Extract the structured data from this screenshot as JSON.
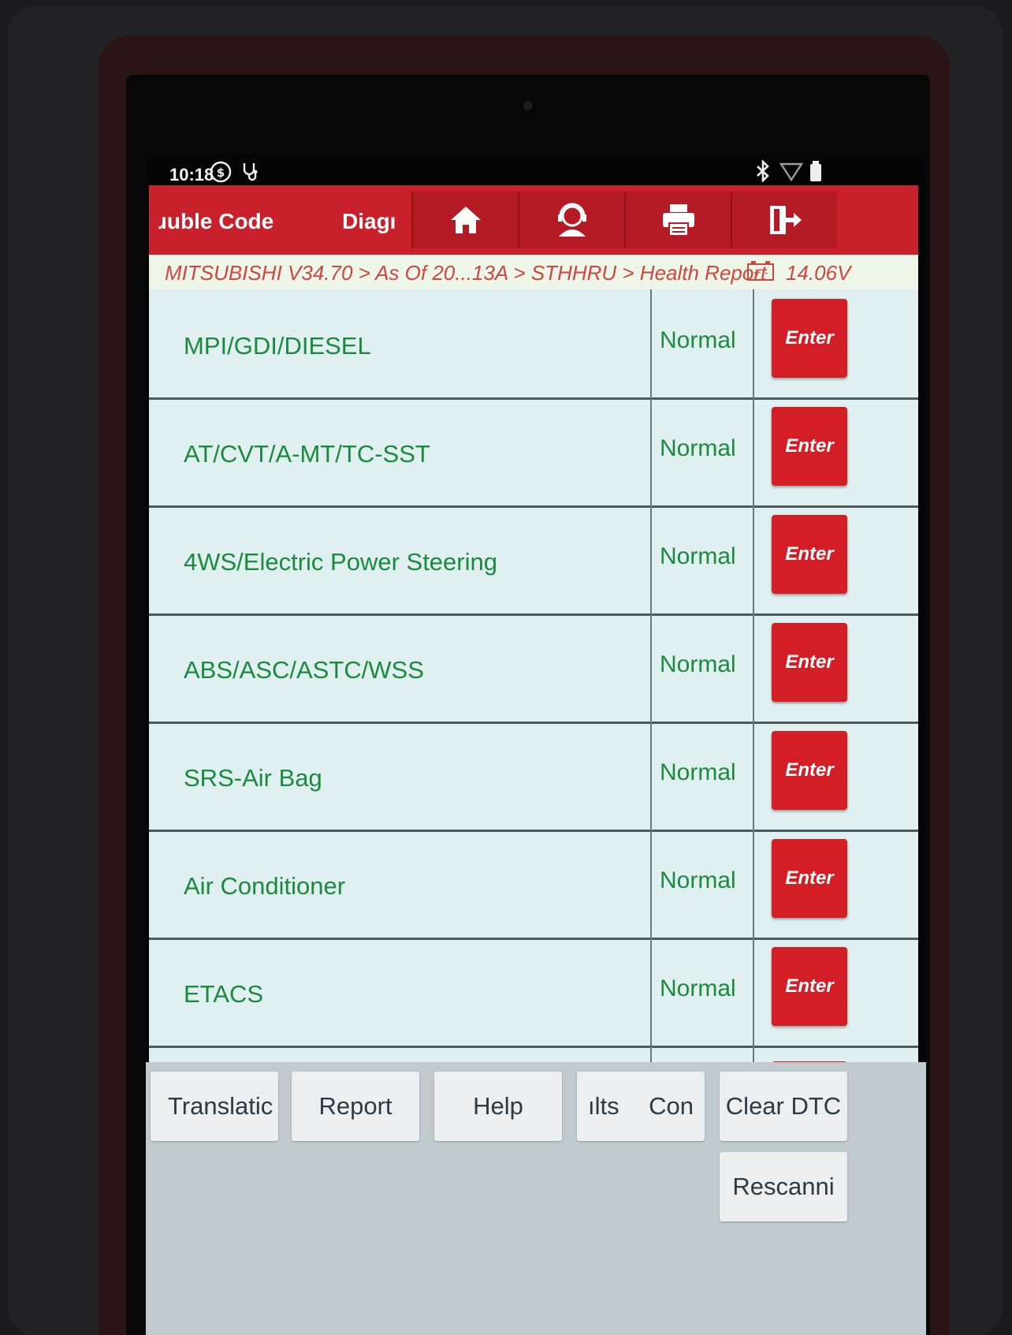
{
  "status_bar": {
    "time": "10:18",
    "icons": [
      "nfc-off-icon",
      "stethoscope-icon",
      "bluetooth-icon",
      "wifi-icon",
      "battery-icon"
    ]
  },
  "header": {
    "tabs": [
      {
        "label": "ɹuble Code"
      },
      {
        "label": "Diagı"
      }
    ],
    "nav_icons": [
      "home-icon",
      "support-agent-icon",
      "print-icon",
      "exit-icon"
    ],
    "accent_color": "#c9212c"
  },
  "breadcrumb": {
    "path": "MITSUBISHI V34.70 > As Of 20...13A > STHHRU > Health Report",
    "voltage": "14.06V"
  },
  "systems": [
    {
      "name": "MPI/GDI/DIESEL",
      "status": "Normal",
      "action": "Enter"
    },
    {
      "name": "AT/CVT/A-MT/TC-SST",
      "status": "Normal",
      "action": "Enter"
    },
    {
      "name": "4WS/Electric Power Steering",
      "status": "Normal",
      "action": "Enter"
    },
    {
      "name": "ABS/ASC/ASTC/WSS",
      "status": "Normal",
      "action": "Enter"
    },
    {
      "name": "SRS-Air Bag",
      "status": "Normal",
      "action": "Enter"
    },
    {
      "name": "Air Conditioner",
      "status": "Normal",
      "action": "Enter"
    },
    {
      "name": "ETACS",
      "status": "Normal",
      "action": "Enter"
    }
  ],
  "toolbar": {
    "translate": "Translatic",
    "report": "Report",
    "help": "Help",
    "results": "ılts",
    "con": "Con",
    "clear_dtc": "Clear DTC",
    "rescan": "Rescanni"
  }
}
